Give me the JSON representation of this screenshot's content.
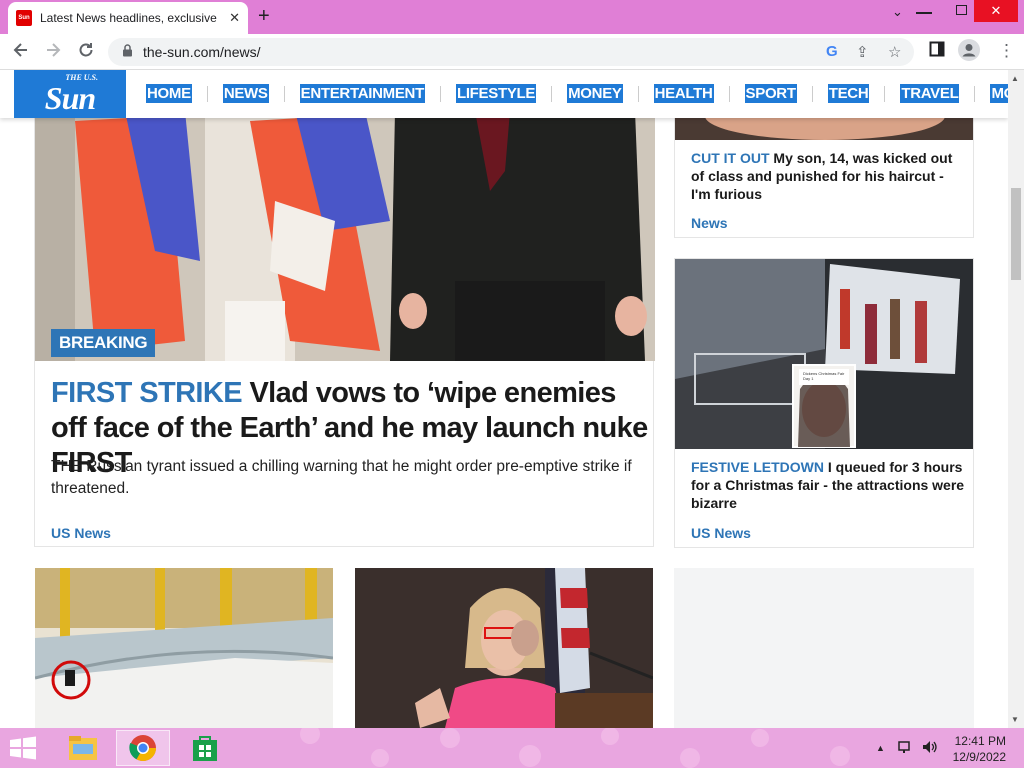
{
  "browser": {
    "tab_title": "Latest News headlines, exclusive",
    "favicon_text": "Sun",
    "url": "the-sun.com/news/"
  },
  "site": {
    "logo_small": "THE U.S.",
    "logo_big": "Sun",
    "nav": [
      "HOME",
      "NEWS",
      "ENTERTAINMENT",
      "LIFESTYLE",
      "MONEY",
      "HEALTH",
      "SPORT",
      "TECH",
      "TRAVEL",
      "MOTORS"
    ]
  },
  "feature": {
    "badge": "BREAKING",
    "kicker": "FIRST STRIKE",
    "headline": " Vlad vows to ‘wipe enemies off face of the Earth’ and he may launch nuke FIRST",
    "standfirst": "THE Russian tyrant issued a chilling warning that he might order pre-emptive strike if threatened.",
    "tag": "US News"
  },
  "side1": {
    "kicker": "CUT IT OUT",
    "headline": " My son, 14, was kicked out of class and punished for his haircut - I'm furious",
    "tag": "News"
  },
  "side2": {
    "kicker": "FESTIVE LETDOWN",
    "headline": " I queued for 3 hours for a Christmas fair - the attractions were bizarre",
    "tag": "US News",
    "overlay": "Dickens Christmas Fair Day 1"
  },
  "taskbar": {
    "time": "12:41 PM",
    "date": "12/9/2022"
  },
  "colors": {
    "brand_blue": "#1f7ad6",
    "kicker_blue": "#2e75b6",
    "chrome_pink": "#e07fd6",
    "taskbar_pink": "#e9a6e0"
  }
}
